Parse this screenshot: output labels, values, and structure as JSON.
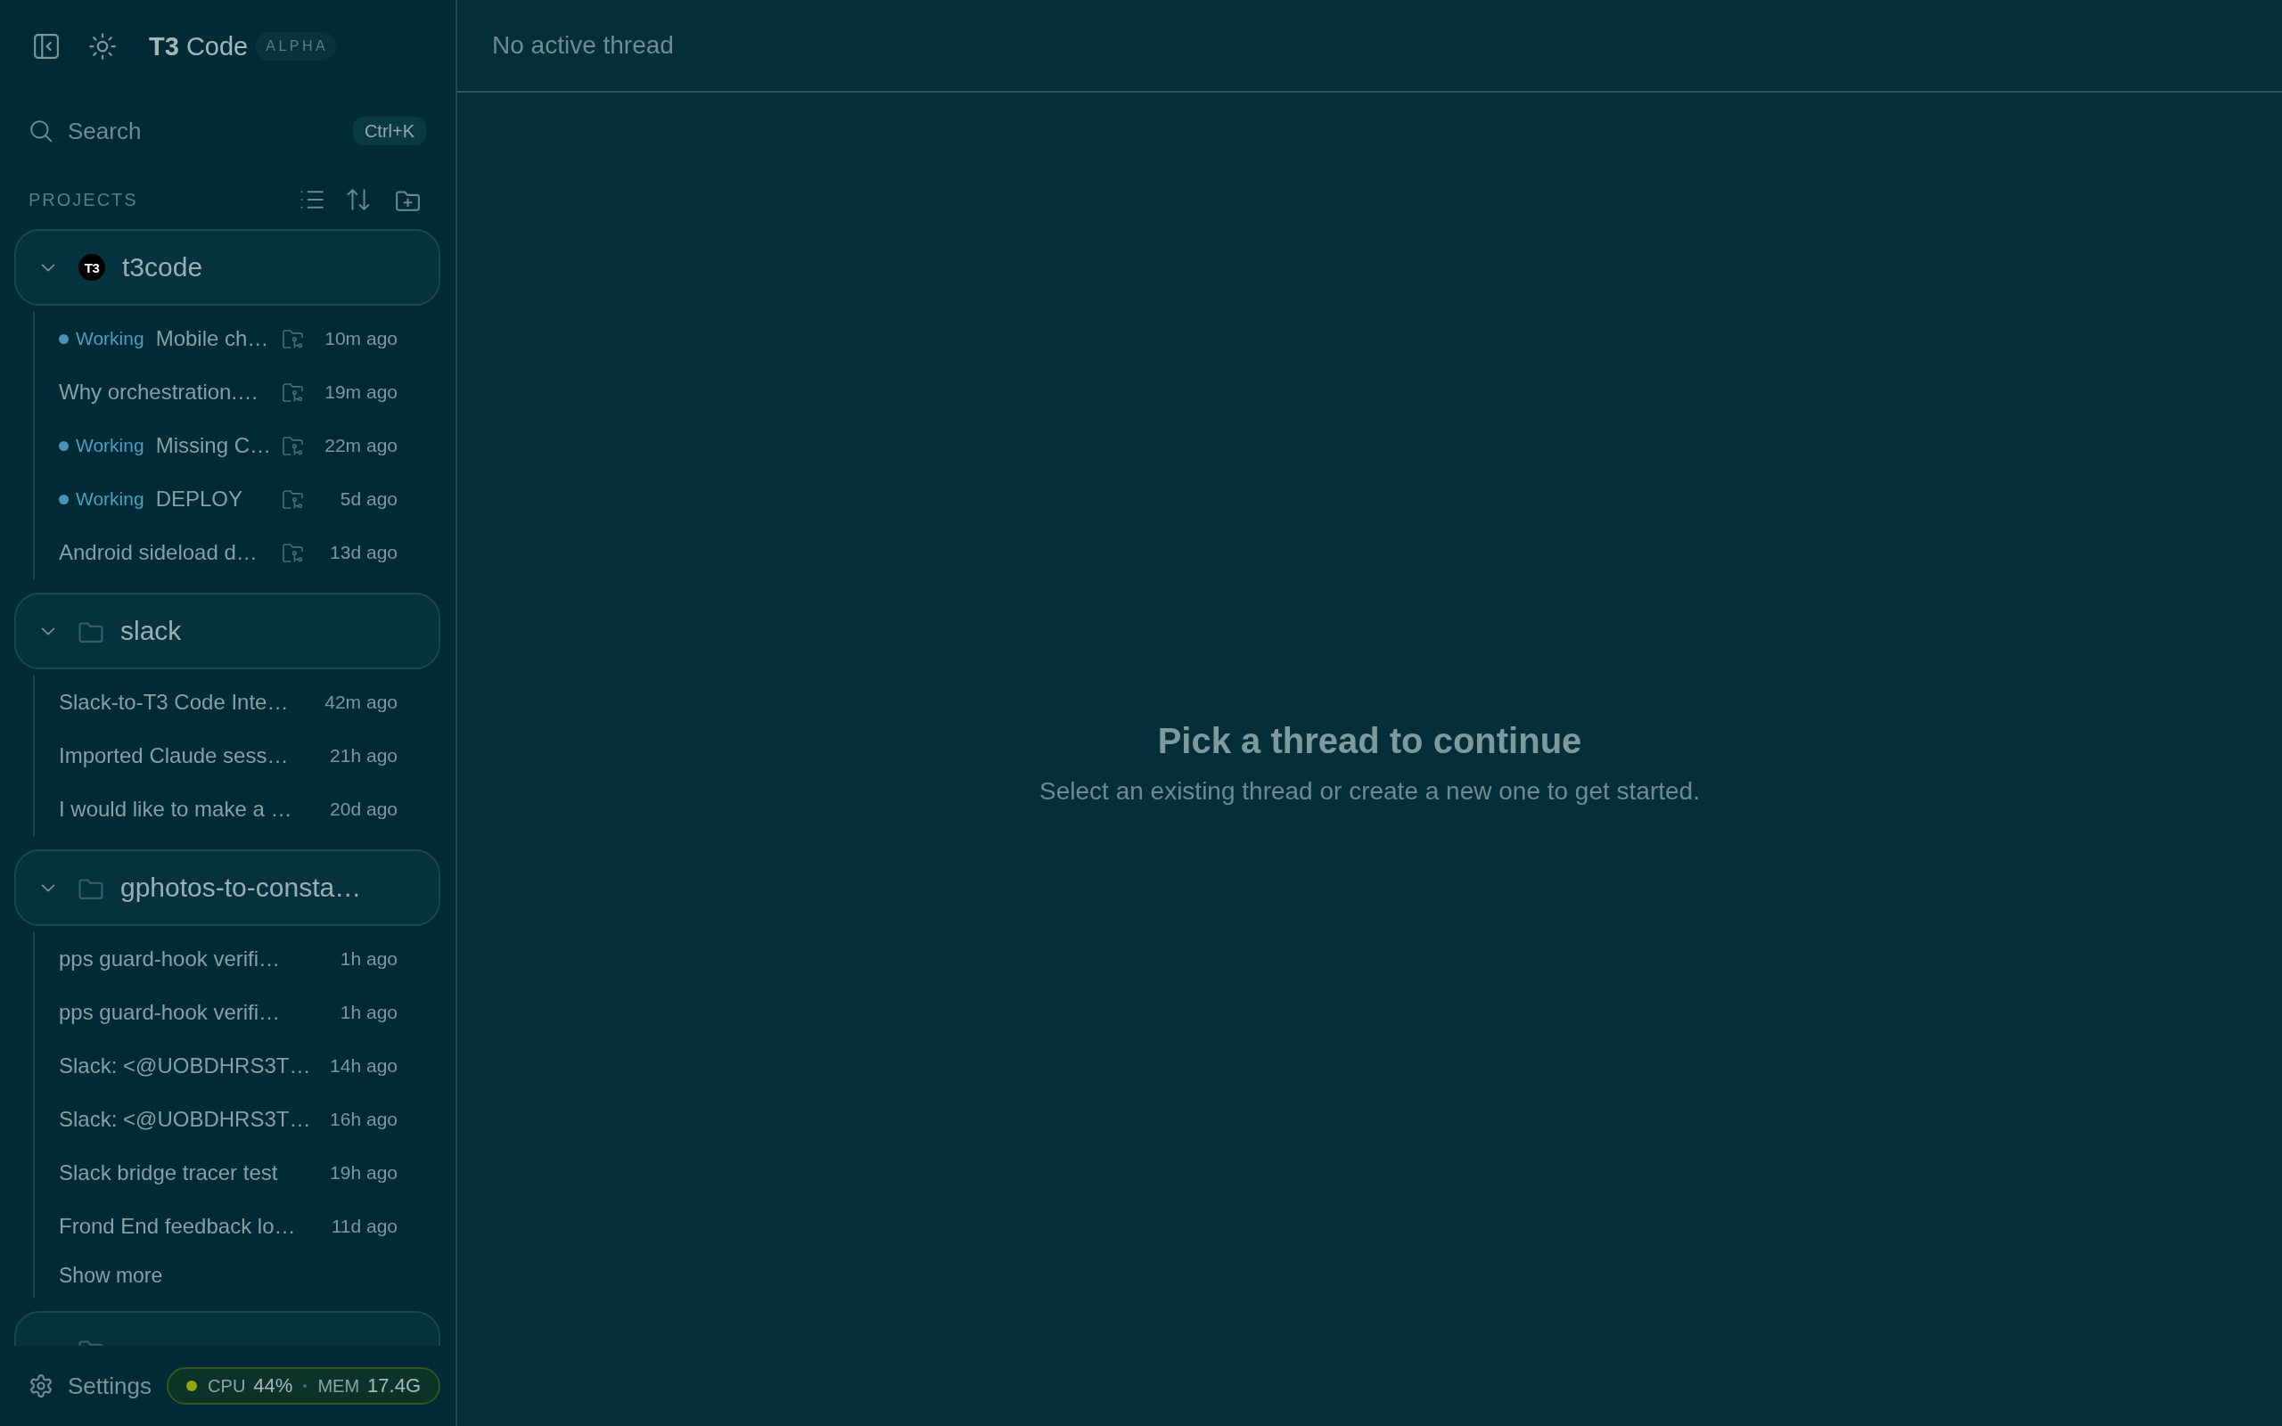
{
  "sidebar": {
    "brand": {
      "title": "**T3** Code",
      "badge": "ALPHA"
    },
    "search": {
      "label": "Search",
      "shortcut": "Ctrl+K"
    },
    "projects_label": "PROJECTS",
    "projects": [
      {
        "name": "t3code",
        "kind": "logo",
        "logo_text": "T3",
        "expanded": true,
        "threads": [
          {
            "status": "Working",
            "title": "Mobile ch…",
            "worktree": true,
            "time": "10m ago"
          },
          {
            "title": "Why orchestration.…",
            "worktree": true,
            "time": "19m ago"
          },
          {
            "status": "Working",
            "title": "Missing C…",
            "worktree": true,
            "time": "22m ago"
          },
          {
            "status": "Working",
            "title": "DEPLOY",
            "worktree": true,
            "time": "5d ago"
          },
          {
            "title": "Android sideload d…",
            "worktree": true,
            "time": "13d ago"
          }
        ]
      },
      {
        "name": "slack",
        "kind": "folder",
        "expanded": true,
        "threads": [
          {
            "title": "Slack-to-T3 Code Inte…",
            "worktree": false,
            "time": "42m ago"
          },
          {
            "title": "Imported Claude sess…",
            "worktree": false,
            "time": "21h ago"
          },
          {
            "title": "I would like to make a …",
            "worktree": false,
            "time": "20d ago"
          }
        ]
      },
      {
        "name": "gphotos-to-consta…",
        "kind": "folder",
        "expanded": true,
        "threads": [
          {
            "title": "pps guard-hook verifi…",
            "worktree": false,
            "time": "1h ago"
          },
          {
            "title": "pps guard-hook verifi…",
            "worktree": false,
            "time": "1h ago"
          },
          {
            "title": "Slack: <@UOBDHRS3T…",
            "worktree": false,
            "time": "14h ago"
          },
          {
            "title": "Slack: <@UOBDHRS3T…",
            "worktree": false,
            "time": "16h ago"
          },
          {
            "title": "Slack bridge tracer test",
            "worktree": false,
            "time": "19h ago"
          },
          {
            "title": "Frond End feedback lo…",
            "worktree": false,
            "time": "11d ago"
          }
        ],
        "show_more": "Show more"
      },
      {
        "kind": "folder"
      }
    ],
    "footer": {
      "settings": "Settings",
      "cpu_label": "CPU",
      "cpu": "44%",
      "mem_label": "MEM",
      "mem": "17.4G"
    }
  },
  "main": {
    "header": "No active thread",
    "empty_title": "Pick a thread to continue",
    "empty_text": "Select an existing thread or create a new one to get started."
  }
}
